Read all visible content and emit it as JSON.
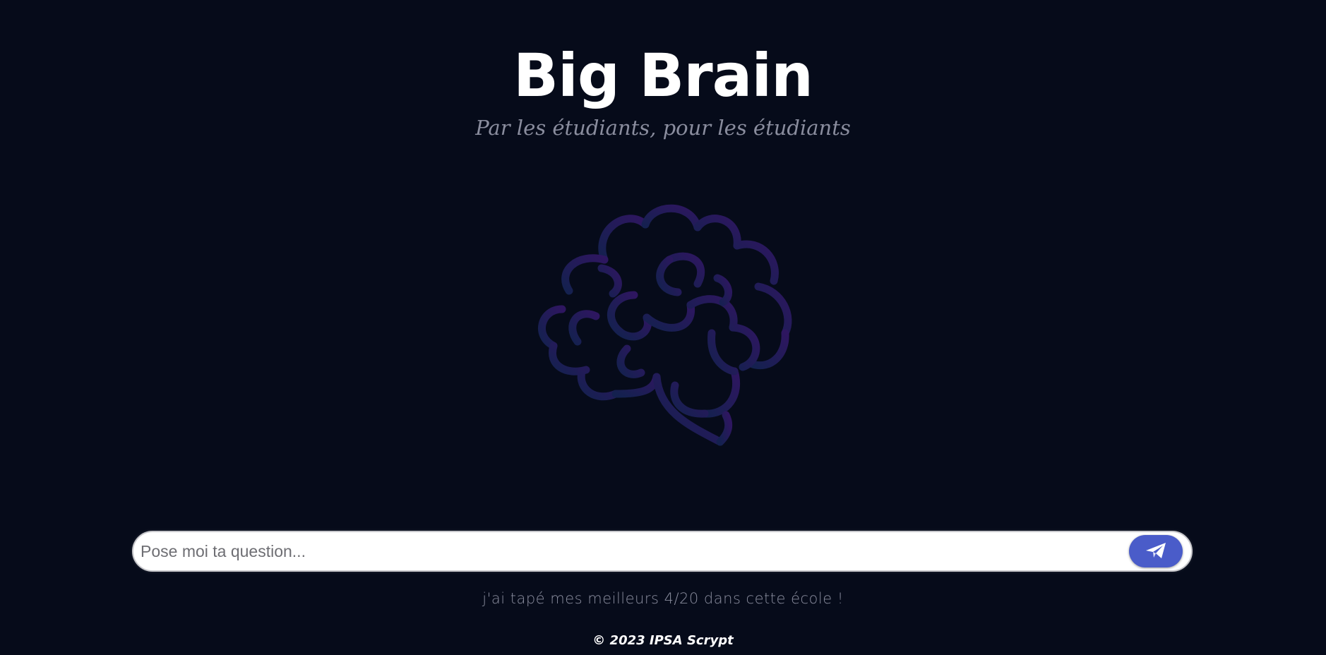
{
  "header": {
    "title": "Big Brain",
    "subtitle": "Par les étudiants, pour les étudiants"
  },
  "logo": {
    "icon": "brain-icon",
    "gradient_start": "#14214f",
    "gradient_end": "#2e1660"
  },
  "search": {
    "placeholder": "Pose moi ta question...",
    "value": "",
    "send_icon": "paper-plane-icon",
    "send_color": "#4a5cc9"
  },
  "tagline": "j'ai tapé mes meilleurs 4/20 dans cette école !",
  "footer": {
    "copyright": "© 2023 IPSA Scrypt"
  },
  "colors": {
    "background": "#060b1a",
    "title": "#ffffff",
    "muted_text": "#8a8d9e"
  }
}
